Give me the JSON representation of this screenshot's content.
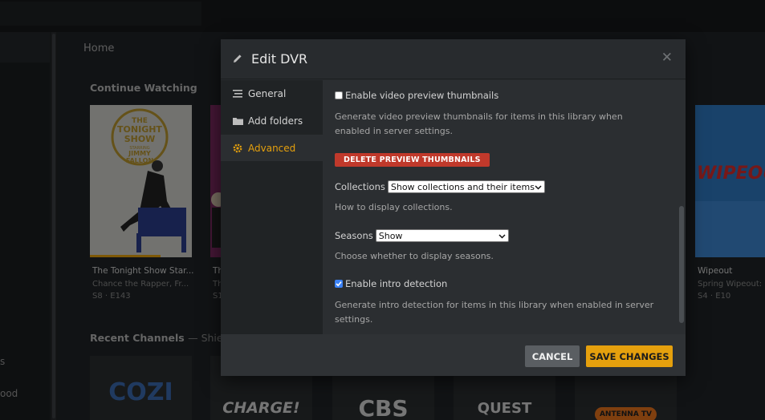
{
  "background": {
    "nav_labels": [
      "s",
      "ood"
    ],
    "home_label": "Home",
    "continue_watching": {
      "title": "Continue Watching",
      "cards": [
        {
          "poster_text": [
            "THE",
            "TONIGHT",
            "SHOW",
            "STARRING",
            "JIMMY",
            "FALLON"
          ],
          "title": "The Tonight Show Star...",
          "subtitle": "Chance the Rapper, Fr...",
          "episode": "S8 · E143",
          "progress": 0.69
        },
        {
          "title": "Th",
          "subtitle": "Th",
          "episode": "S1"
        },
        {
          "poster_text": [
            "WIPEOU"
          ],
          "title": "Wipeout",
          "subtitle": "Spring Wipeout: S",
          "episode": "S4 · E10"
        }
      ]
    },
    "recent_channels": {
      "title": "Recent Channels",
      "sub": "— Shield",
      "logos": [
        "COZI",
        "CHARGE!",
        "CBS",
        "QUEST",
        "ANTENNA TV"
      ]
    }
  },
  "modal": {
    "title": "Edit DVR",
    "close_icon": "close-icon",
    "menu": [
      {
        "label": "General",
        "icon": "list-icon",
        "active": false
      },
      {
        "label": "Add folders",
        "icon": "folder-icon",
        "active": false
      },
      {
        "label": "Advanced",
        "icon": "gear-icon",
        "active": true
      }
    ],
    "advanced": {
      "video_preview": {
        "label": "Enable video preview thumbnails",
        "checked": false,
        "help": "Generate video preview thumbnails for items in this library when enabled in server settings."
      },
      "delete_button": "DELETE PREVIEW THUMBNAILS",
      "collections": {
        "label": "Collections",
        "value": "Show collections and their items",
        "help": "How to display collections."
      },
      "seasons": {
        "label": "Seasons",
        "value": "Show",
        "help": "Choose whether to display seasons."
      },
      "intro_detection": {
        "label": "Enable intro detection",
        "checked": true,
        "help": "Generate intro detection for items in this library when enabled in server settings."
      }
    },
    "footer": {
      "cancel": "CANCEL",
      "save": "SAVE CHANGES"
    }
  },
  "colors": {
    "accent": "#e5a00d",
    "danger": "#c0392b"
  }
}
